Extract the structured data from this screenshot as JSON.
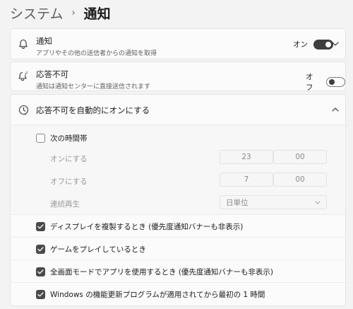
{
  "breadcrumb": {
    "root": "システム",
    "separator": "›",
    "current": "通知"
  },
  "notifications": {
    "title": "通知",
    "subtitle": "アプリやその他の送信者からの通知を取得",
    "toggle_label": "オン",
    "toggle_state": "on"
  },
  "dnd": {
    "title": "応答不可",
    "subtitle": "通知は通知センターに直接送信されます",
    "toggle_label": "オフ",
    "toggle_state": "off"
  },
  "auto_dnd": {
    "title": "応答不可を自動的にオンにする",
    "time_range": {
      "label": "次の時間帯",
      "checked": false,
      "on_label": "オンにする",
      "on_hour": "23",
      "on_minute": "00",
      "off_label": "オフにする",
      "off_hour": "7",
      "off_minute": "00",
      "repeat_label": "連続再生",
      "repeat_value": "日単位"
    },
    "options": [
      {
        "label": "ディスプレイを複製するとき (優先度通知バナーも非表示)",
        "checked": true
      },
      {
        "label": "ゲームをプレイしているとき",
        "checked": true
      },
      {
        "label": "全画面モードでアプリを使用するとき (優先度通知バナーも非表示)",
        "checked": true
      },
      {
        "label": "Windows の機能更新プログラムが適用されてから最初の 1 時間",
        "checked": true
      }
    ]
  }
}
